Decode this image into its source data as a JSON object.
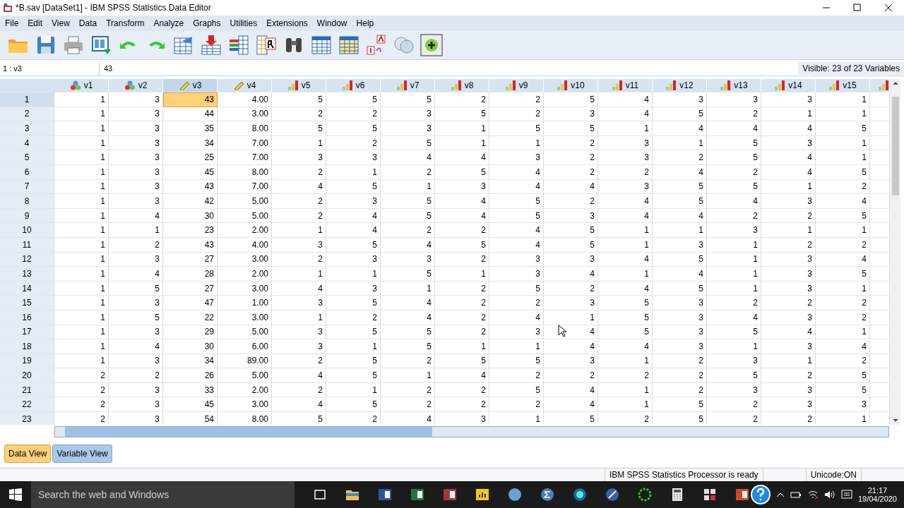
{
  "window": {
    "title": "*B.sav [DataSet1] - IBM SPSS Statistics Data Editor"
  },
  "menu": [
    "File",
    "Edit",
    "View",
    "Data",
    "Transform",
    "Analyze",
    "Graphs",
    "Utilities",
    "Extensions",
    "Window",
    "Help"
  ],
  "cell_editor": {
    "reference": "1 : v3",
    "value": "43",
    "visible": "Visible: 23 of 23 Variables"
  },
  "table": {
    "columns": [
      {
        "name": "v1",
        "kind": "nominal",
        "selected": false
      },
      {
        "name": "v2",
        "kind": "nominal",
        "selected": false
      },
      {
        "name": "v3",
        "kind": "scale",
        "selected": true
      },
      {
        "name": "v4",
        "kind": "scale",
        "selected": false
      },
      {
        "name": "v5",
        "kind": "ordinal",
        "selected": false
      },
      {
        "name": "v6",
        "kind": "ordinal",
        "selected": false
      },
      {
        "name": "v7",
        "kind": "ordinal",
        "selected": false
      },
      {
        "name": "v8",
        "kind": "ordinal",
        "selected": false
      },
      {
        "name": "v9",
        "kind": "ordinal",
        "selected": false
      },
      {
        "name": "v10",
        "kind": "ordinal",
        "selected": false
      },
      {
        "name": "v11",
        "kind": "ordinal",
        "selected": false
      },
      {
        "name": "v12",
        "kind": "ordinal",
        "selected": false
      },
      {
        "name": "v13",
        "kind": "ordinal",
        "selected": false
      },
      {
        "name": "v14",
        "kind": "ordinal",
        "selected": false
      },
      {
        "name": "v15",
        "kind": "ordinal",
        "selected": false
      },
      {
        "kind": "ordinal",
        "selected": false
      }
    ],
    "rows": [
      {
        "label": "1",
        "selected": true,
        "cells": [
          "1",
          "3",
          "43",
          "4.00",
          "5",
          "5",
          "5",
          "2",
          "2",
          "5",
          "4",
          "3",
          "3",
          "3",
          "1"
        ]
      },
      {
        "label": "2",
        "selected": false,
        "cells": [
          "1",
          "3",
          "44",
          "3.00",
          "2",
          "2",
          "3",
          "5",
          "2",
          "3",
          "4",
          "5",
          "2",
          "1",
          "1"
        ]
      },
      {
        "label": "3",
        "selected": false,
        "cells": [
          "1",
          "3",
          "35",
          "8.00",
          "5",
          "5",
          "3",
          "1",
          "5",
          "5",
          "1",
          "4",
          "4",
          "4",
          "5"
        ]
      },
      {
        "label": "4",
        "selected": false,
        "cells": [
          "1",
          "3",
          "34",
          "7.00",
          "1",
          "2",
          "5",
          "1",
          "1",
          "2",
          "3",
          "1",
          "5",
          "3",
          "1"
        ]
      },
      {
        "label": "5",
        "selected": false,
        "cells": [
          "1",
          "3",
          "25",
          "7.00",
          "3",
          "3",
          "4",
          "4",
          "3",
          "2",
          "3",
          "2",
          "5",
          "4",
          "1"
        ]
      },
      {
        "label": "6",
        "selected": false,
        "cells": [
          "1",
          "3",
          "45",
          "8.00",
          "2",
          "1",
          "2",
          "5",
          "4",
          "2",
          "2",
          "4",
          "2",
          "4",
          "5"
        ]
      },
      {
        "label": "7",
        "selected": false,
        "cells": [
          "1",
          "3",
          "43",
          "7.00",
          "4",
          "5",
          "1",
          "3",
          "4",
          "4",
          "3",
          "5",
          "5",
          "1",
          "2"
        ]
      },
      {
        "label": "8",
        "selected": false,
        "cells": [
          "1",
          "3",
          "42",
          "5.00",
          "2",
          "3",
          "5",
          "4",
          "5",
          "2",
          "4",
          "5",
          "4",
          "3",
          "4"
        ]
      },
      {
        "label": "9",
        "selected": false,
        "cells": [
          "1",
          "4",
          "30",
          "5.00",
          "2",
          "4",
          "5",
          "4",
          "5",
          "3",
          "4",
          "4",
          "2",
          "2",
          "5"
        ]
      },
      {
        "label": "10",
        "selected": false,
        "cells": [
          "1",
          "1",
          "23",
          "2.00",
          "1",
          "4",
          "2",
          "2",
          "4",
          "5",
          "1",
          "1",
          "3",
          "1",
          "1"
        ]
      },
      {
        "label": "11",
        "selected": false,
        "cells": [
          "1",
          "2",
          "43",
          "4.00",
          "3",
          "5",
          "4",
          "5",
          "4",
          "5",
          "1",
          "3",
          "1",
          "2",
          "2"
        ]
      },
      {
        "label": "12",
        "selected": false,
        "cells": [
          "1",
          "3",
          "27",
          "3.00",
          "2",
          "3",
          "3",
          "2",
          "3",
          "3",
          "4",
          "5",
          "1",
          "3",
          "4"
        ]
      },
      {
        "label": "13",
        "selected": false,
        "cells": [
          "1",
          "4",
          "28",
          "2.00",
          "1",
          "1",
          "5",
          "1",
          "3",
          "4",
          "1",
          "4",
          "1",
          "3",
          "5"
        ]
      },
      {
        "label": "14",
        "selected": false,
        "cells": [
          "1",
          "5",
          "27",
          "3.00",
          "4",
          "3",
          "1",
          "2",
          "5",
          "2",
          "4",
          "5",
          "1",
          "3",
          "1"
        ]
      },
      {
        "label": "15",
        "selected": false,
        "cells": [
          "1",
          "3",
          "47",
          "1.00",
          "3",
          "5",
          "4",
          "2",
          "2",
          "3",
          "5",
          "3",
          "2",
          "2",
          "2"
        ]
      },
      {
        "label": "16",
        "selected": false,
        "cells": [
          "1",
          "5",
          "22",
          "3.00",
          "1",
          "2",
          "4",
          "2",
          "4",
          "1",
          "5",
          "3",
          "4",
          "3",
          "2"
        ]
      },
      {
        "label": "17",
        "selected": false,
        "cells": [
          "1",
          "3",
          "29",
          "5.00",
          "3",
          "5",
          "5",
          "2",
          "3",
          "4",
          "5",
          "3",
          "5",
          "4",
          "1"
        ]
      },
      {
        "label": "18",
        "selected": false,
        "cells": [
          "1",
          "4",
          "30",
          "6.00",
          "3",
          "1",
          "5",
          "1",
          "1",
          "4",
          "4",
          "3",
          "1",
          "3",
          "4"
        ]
      },
      {
        "label": "19",
        "selected": false,
        "cells": [
          "1",
          "3",
          "34",
          "89.00",
          "2",
          "5",
          "2",
          "5",
          "5",
          "3",
          "1",
          "2",
          "3",
          "1",
          "2"
        ]
      },
      {
        "label": "20",
        "selected": false,
        "cells": [
          "2",
          "2",
          "26",
          "5.00",
          "4",
          "5",
          "1",
          "4",
          "2",
          "2",
          "2",
          "2",
          "5",
          "2",
          "5"
        ]
      },
      {
        "label": "21",
        "selected": false,
        "cells": [
          "2",
          "3",
          "33",
          "2.00",
          "2",
          "1",
          "2",
          "2",
          "5",
          "4",
          "1",
          "2",
          "3",
          "3",
          "5"
        ]
      },
      {
        "label": "22",
        "selected": false,
        "cells": [
          "2",
          "3",
          "45",
          "3.00",
          "4",
          "5",
          "2",
          "2",
          "2",
          "4",
          "1",
          "5",
          "2",
          "3",
          "3"
        ]
      },
      {
        "label": "23",
        "selected": false,
        "cells": [
          "2",
          "3",
          "54",
          "8.00",
          "5",
          "2",
          "4",
          "3",
          "1",
          "5",
          "2",
          "5",
          "2",
          "2",
          "1"
        ]
      }
    ]
  },
  "view_tabs": [
    {
      "label": "Data View",
      "selected": true
    },
    {
      "label": "Variable View",
      "selected": false
    }
  ],
  "status_bar": {
    "processor": "IBM SPSS Statistics Processor is ready",
    "unicode": "Unicode:ON"
  },
  "taskbar": {
    "search_placeholder": "Search the web and Windows",
    "time": "21:17",
    "date": "19/04/2020"
  }
}
